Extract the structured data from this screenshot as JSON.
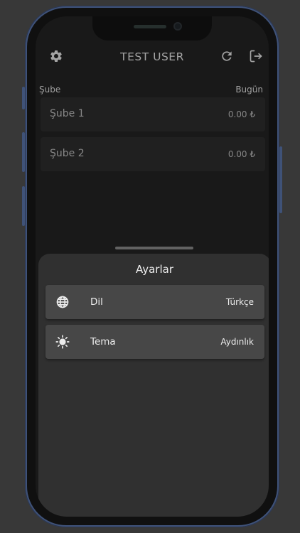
{
  "header": {
    "title": "TEST USER"
  },
  "table": {
    "col_branch": "Şube",
    "col_today": "Bugün",
    "rows": [
      {
        "name": "Şube 1",
        "value": "0.00 ₺"
      },
      {
        "name": "Şube 2",
        "value": "0.00 ₺"
      }
    ]
  },
  "settings_sheet": {
    "title": "Ayarlar",
    "items": [
      {
        "icon": "globe-icon",
        "label": "Dil",
        "value": "Türkçe"
      },
      {
        "icon": "sun-icon",
        "label": "Tema",
        "value": "Aydınlık"
      }
    ]
  },
  "icons": {
    "settings": "gear-icon",
    "refresh": "refresh-icon",
    "logout": "logout-icon"
  },
  "colors": {
    "background": "#383838",
    "screen": "#1f1f1f",
    "sheet": "#303030",
    "row": "#474747",
    "phone_frame": "#3f5278"
  }
}
